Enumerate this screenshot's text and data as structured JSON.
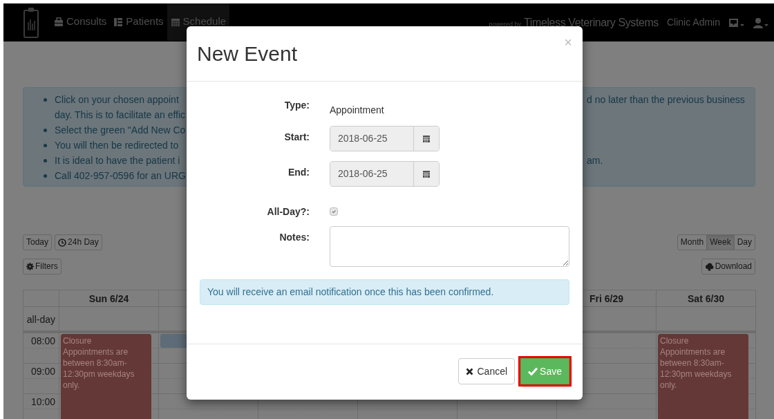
{
  "navbar": {
    "links": [
      {
        "label": "Consults",
        "selected": false
      },
      {
        "label": "Patients",
        "selected": false
      },
      {
        "label": "Schedule",
        "selected": true
      }
    ],
    "brand_prefix": "powered by",
    "brand": "Timeless Veterinary Systems",
    "user": "Clinic Admin"
  },
  "notice": {
    "lines": [
      {
        "kind": "bullet",
        "left": "Click on your chosen appoint",
        "right": "d no later than the previous business"
      },
      {
        "kind": "continuation",
        "left": "day. This is to facilitate an effic"
      },
      {
        "kind": "bullet",
        "left": "Select the green \"Add New Co"
      },
      {
        "kind": "bullet",
        "left": "You will then be redirected to"
      },
      {
        "kind": "bullet",
        "left": "It is ideal to have the patient i",
        "right": "am."
      },
      {
        "kind": "bullet",
        "left": "Call 402-957-0596 for an URG"
      }
    ]
  },
  "toolbar": {
    "left": [
      {
        "kind": "plain",
        "label": "Today"
      },
      {
        "kind": "clock",
        "label": "24h Day"
      }
    ],
    "filters": {
      "label": "Filters"
    },
    "views": [
      {
        "label": "Month",
        "selected": false
      },
      {
        "label": "Week",
        "selected": true
      },
      {
        "label": "Day",
        "selected": false
      }
    ],
    "download": {
      "label": "Download"
    }
  },
  "calendar": {
    "allday_label": "all-day",
    "times": [
      "08:00",
      "09:00",
      "10:00"
    ],
    "days_left": [
      {
        "label": "Sun 6/24",
        "events": [
          {
            "kind": "closure",
            "title": "Closure",
            "text": "Appointments are between 8:30am-12:30pm weekdays only.",
            "color": "#633836"
          }
        ]
      },
      {
        "events": [
          {
            "kind": "appointment",
            "color": "#5d6c78"
          }
        ]
      }
    ],
    "days_right": [
      {
        "label": "Fri 6/29"
      },
      {
        "label": "Sat 6/30",
        "events": [
          {
            "kind": "closure",
            "title": "Closure",
            "text": "Appointments are between 8:30am-12:30pm weekdays only.",
            "color": "#633836"
          }
        ]
      }
    ]
  },
  "modal": {
    "title": "New Event",
    "close": "×",
    "fields": [
      {
        "kind": "text",
        "label": "Type:",
        "value": "Appointment"
      },
      {
        "kind": "date",
        "label": "Start:",
        "value": "2018-06-25"
      },
      {
        "kind": "date",
        "label": "End:",
        "value": "2018-06-25"
      },
      {
        "kind": "checkbox",
        "label": "All-Day?:",
        "checked": true,
        "disabled": true
      },
      {
        "kind": "textarea",
        "label": "Notes:"
      }
    ],
    "info": "You will receive an email notification once this has been confirmed.",
    "buttons": [
      {
        "kind": "cancel",
        "label": "Cancel",
        "highlighted": false
      },
      {
        "kind": "save",
        "label": "Save",
        "highlighted": true
      }
    ]
  }
}
